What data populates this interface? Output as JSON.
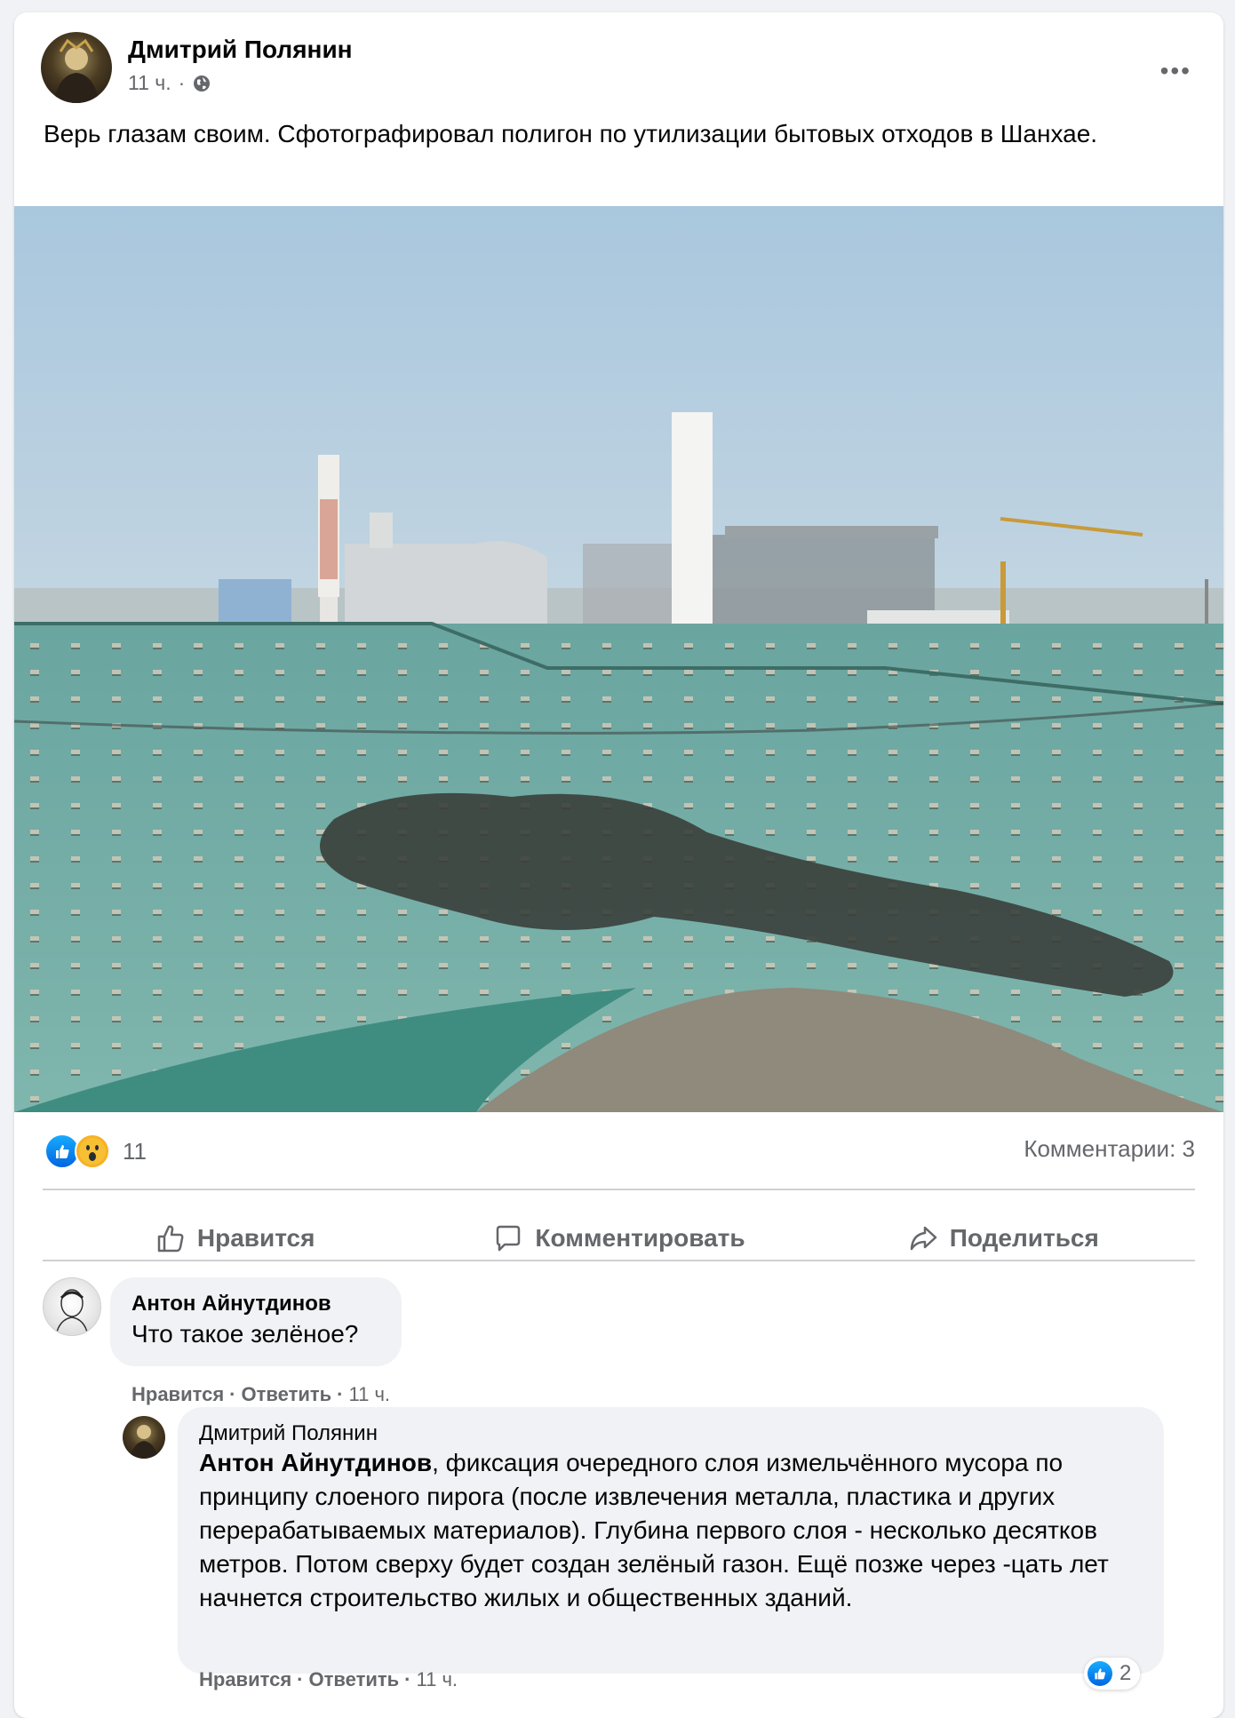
{
  "post": {
    "author": "Дмитрий Полянин",
    "time": "11 ч.",
    "dot": "·",
    "more": "•••",
    "text": "Верь глазам своим. Сфотографировал полигон по утилизации бытовых отходов в Шанхае.",
    "reaction_count": "11",
    "comments_label": "Комментарии: 3"
  },
  "actions": {
    "like": "Нравится",
    "comment": "Комментировать",
    "share": "Поделиться"
  },
  "comments": [
    {
      "author": "Антон Айнутдинов",
      "text": "Что такое зелёное?",
      "like": "Нравится",
      "reply": "Ответить",
      "time": "11 ч."
    },
    {
      "author": "Дмитрий Полянин",
      "mention": "Антон Айнутдинов",
      "text": ", фиксация очередного слоя измельчённого мусора по принципу слоеного пирога (после извлечения металла, пластика и других перерабатываемых материалов). Глубина первого слоя - несколько десятков метров. Потом сверху будет создан зелёный газон. Ещё позже через -цать лет начнется строительство жилых и общественных зданий.",
      "like": "Нравится",
      "reply": "Ответить",
      "time": "11 ч.",
      "reaction_count": "2"
    }
  ],
  "sep": "·"
}
